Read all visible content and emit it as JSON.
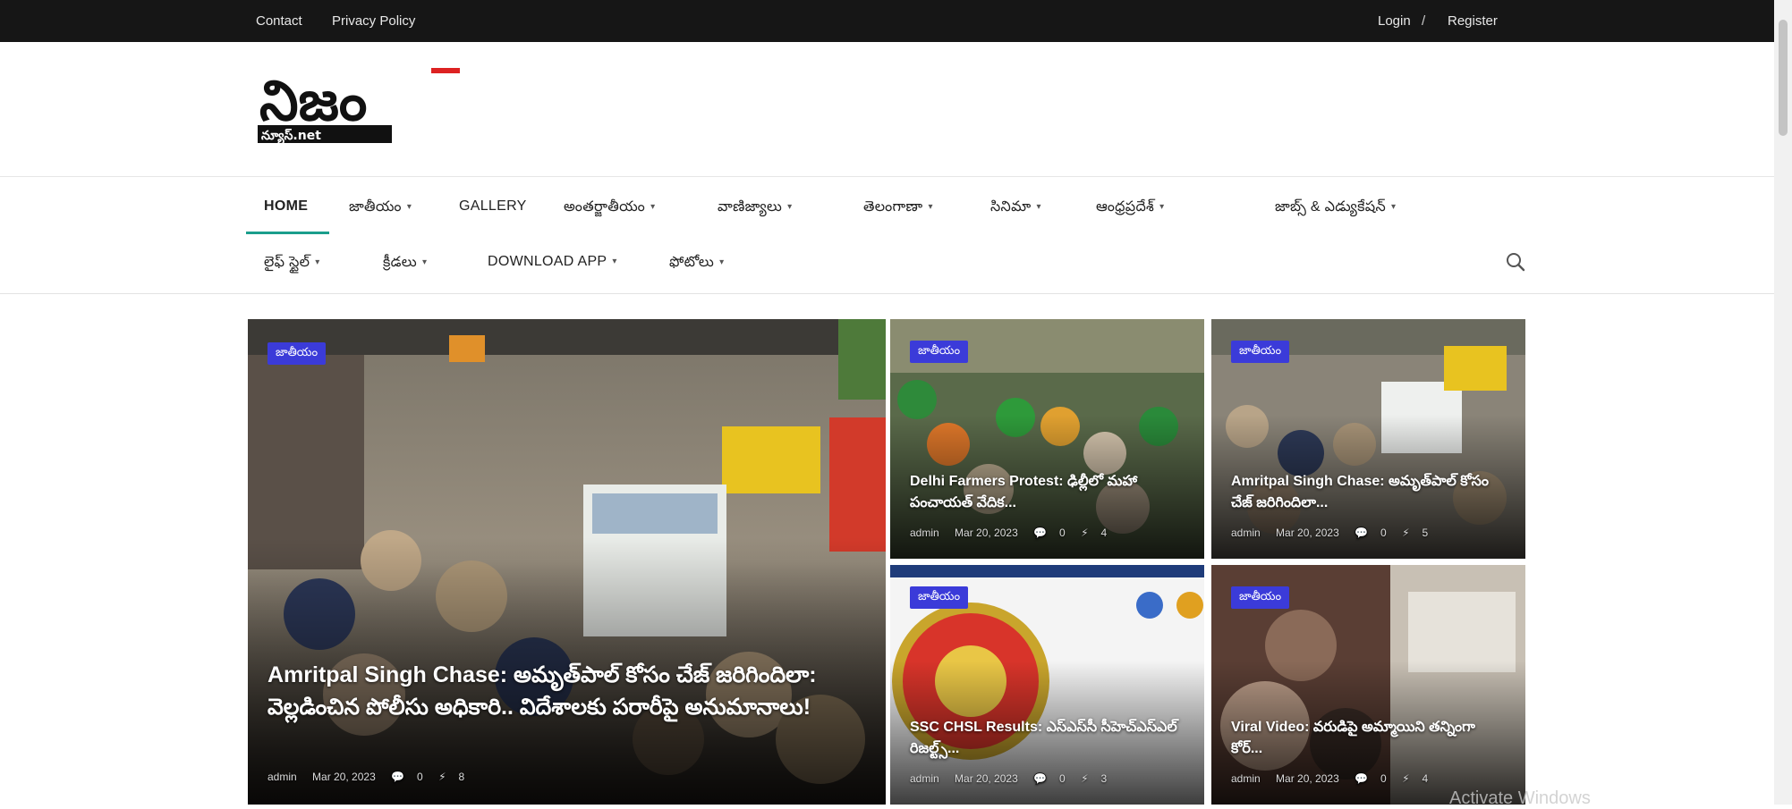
{
  "topbar": {
    "links": [
      "Contact",
      "Privacy Policy"
    ],
    "login": "Login",
    "separator": "/",
    "register": "Register"
  },
  "logo": {
    "main": "నిజం",
    "sub": "న్యూస్.net"
  },
  "nav": {
    "row1": [
      {
        "label": "HOME",
        "caret": false
      },
      {
        "label": "జాతీయం",
        "caret": true
      },
      {
        "label": "GALLERY",
        "caret": false
      },
      {
        "label": "అంతర్జాతీయం",
        "caret": true
      },
      {
        "label": "వాణిజ్యాలు",
        "caret": true
      },
      {
        "label": "తెలంగాణా",
        "caret": true
      },
      {
        "label": "సినిమా",
        "caret": true
      },
      {
        "label": "ఆంధ్రప్రదేశ్",
        "caret": true
      },
      {
        "label": "జాబ్స్ & ఎడ్యుకేషన్",
        "caret": true
      }
    ],
    "row2": [
      {
        "label": "లైఫ్ స్టైల్",
        "caret": true
      },
      {
        "label": "క్రీడలు",
        "caret": true
      },
      {
        "label": "DOWNLOAD APP",
        "caret": true
      },
      {
        "label": "ఫోటోలు",
        "caret": true
      }
    ]
  },
  "posts": [
    {
      "badge": "జాతీయం",
      "title": "Amritpal Singh Chase: అమృత్‌పాల్ కోసం చేజ్ జరిగిందిలా: వెల్లడించిన పోలీసు అధికారి.. విదేశాలకు పరారీపై అనుమానాలు!",
      "author": "admin",
      "date": "Mar 20, 2023",
      "comments": "0",
      "views": "8"
    },
    {
      "badge": "జాతీయం",
      "title": "Delhi Farmers Protest: ఢిల్లీలో మహా పంచాయత్ వేదిక...",
      "author": "admin",
      "date": "Mar 20, 2023",
      "comments": "0",
      "views": "4"
    },
    {
      "badge": "జాతీయం",
      "title": "Amritpal Singh Chase: అమృత్‌పాల్ కోసం చేజ్ జరిగిందిలా...",
      "author": "admin",
      "date": "Mar 20, 2023",
      "comments": "0",
      "views": "5"
    },
    {
      "badge": "జాతీయం",
      "title": "SSC CHSL Results: ఎస్ఎస్‌సీ సీహెచ్ఎస్ఎల్ రిజల్ట్స్...",
      "author": "admin",
      "date": "Mar 20, 2023",
      "comments": "0",
      "views": "3"
    },
    {
      "badge": "జాతీయం",
      "title": "Viral Video: వరుడిపై అమ్మాయిని తన్నింగా కోర్...",
      "author": "admin",
      "date": "Mar 20, 2023",
      "comments": "0",
      "views": "4"
    }
  ],
  "watermark": "Activate Windows",
  "colors": {
    "topbar": "#161616",
    "accent": "#1a9e8c",
    "badge": "#3b3bd9"
  }
}
